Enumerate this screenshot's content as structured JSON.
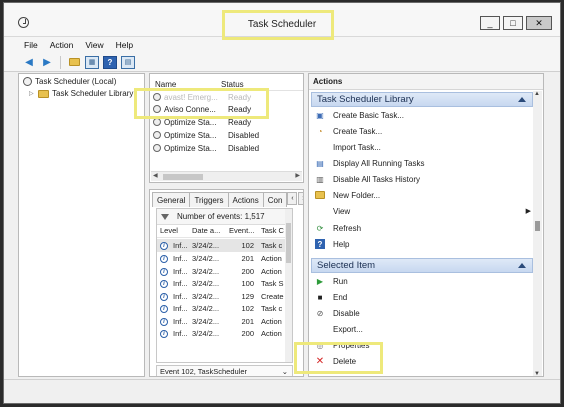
{
  "window": {
    "title": "Task Scheduler",
    "controls": [
      "_",
      "□",
      "✕"
    ]
  },
  "menu": [
    "File",
    "Action",
    "View",
    "Help"
  ],
  "tree": {
    "root": "Task Scheduler (Local)",
    "child": "Task Scheduler Library"
  },
  "tasks": {
    "columns": [
      "Name",
      "Status"
    ],
    "rows": [
      {
        "name": "avast! Emerg...",
        "status": "Ready",
        "faded": true
      },
      {
        "name": "Aviso Conne...",
        "status": "Ready"
      },
      {
        "name": "Optimize Sta...",
        "status": "Ready"
      },
      {
        "name": "Optimize Sta...",
        "status": "Disabled"
      },
      {
        "name": "Optimize Sta...",
        "status": "Disabled"
      }
    ]
  },
  "detail": {
    "tabs": [
      "General",
      "Triggers",
      "Actions",
      "Con"
    ],
    "events_label": "Number of events: 1,517",
    "columns": [
      "Level",
      "Date a...",
      "Event...",
      "Task C"
    ],
    "rows": [
      {
        "level": "Inf...",
        "date": "3/24/2...",
        "event": "102",
        "task": "Task c"
      },
      {
        "level": "Inf...",
        "date": "3/24/2...",
        "event": "201",
        "task": "Action"
      },
      {
        "level": "Inf...",
        "date": "3/24/2...",
        "event": "200",
        "task": "Action"
      },
      {
        "level": "Inf...",
        "date": "3/24/2...",
        "event": "100",
        "task": "Task S"
      },
      {
        "level": "Inf...",
        "date": "3/24/2...",
        "event": "129",
        "task": "Create"
      },
      {
        "level": "Inf...",
        "date": "3/24/2...",
        "event": "102",
        "task": "Task c"
      },
      {
        "level": "Inf...",
        "date": "3/24/2...",
        "event": "201",
        "task": "Action"
      },
      {
        "level": "Inf...",
        "date": "3/24/2...",
        "event": "200",
        "task": "Action"
      }
    ],
    "footer": "Event 102, TaskScheduler"
  },
  "actions": {
    "title": "Actions",
    "library_header": "Task Scheduler Library",
    "library_items": [
      {
        "label": "Create Basic Task...",
        "icon": "create-basic-task-icon"
      },
      {
        "label": "Create Task...",
        "icon": "create-task-icon"
      },
      {
        "label": "Import Task...",
        "icon": ""
      },
      {
        "label": "Display All Running Tasks",
        "icon": "running-tasks-icon"
      },
      {
        "label": "Disable All Tasks History",
        "icon": "history-icon"
      },
      {
        "label": "New Folder...",
        "icon": "folder-icon"
      },
      {
        "label": "View",
        "icon": "",
        "submenu": true
      },
      {
        "label": "Refresh",
        "icon": "refresh-icon"
      },
      {
        "label": "Help",
        "icon": "help-icon"
      }
    ],
    "selected_header": "Selected Item",
    "selected_items": [
      {
        "label": "Run",
        "icon": "run-icon"
      },
      {
        "label": "End",
        "icon": "end-icon"
      },
      {
        "label": "Disable",
        "icon": "disable-icon"
      },
      {
        "label": "Export...",
        "icon": ""
      },
      {
        "label": "Properties",
        "icon": "properties-icon"
      },
      {
        "label": "Delete",
        "icon": "delete-icon"
      }
    ]
  },
  "colors": {
    "highlight": "#eee97b",
    "section_header": "#c7d8f0"
  }
}
